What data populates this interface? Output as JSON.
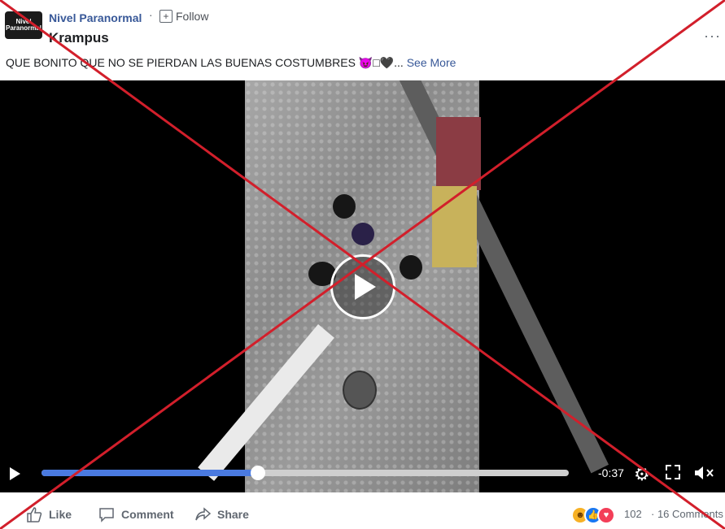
{
  "post": {
    "page_name": "Nivel Paranormal",
    "separator": "·",
    "follow_label": "Follow",
    "title": "Krampus",
    "more_label": "···",
    "caption_text": "QUE BONITO QUE NO SE PIERDAN LAS BUENAS COSTUMBRES 😈□🖤...",
    "see_more_label": "See More",
    "avatar_text": "Nivel Paranormal"
  },
  "video": {
    "time_remaining": "-0:37",
    "progress_fraction": 0.41
  },
  "actions": {
    "like_label": "Like",
    "comment_label": "Comment",
    "share_label": "Share"
  },
  "stats": {
    "reaction_count": "102",
    "comments_label": "· 16 Comments"
  },
  "overlay": {
    "cross_color": "#d21f2b"
  },
  "icons": [
    "avatar-logo",
    "follow-icon",
    "more-options-icon",
    "play-icon",
    "settings-gear-icon",
    "fullscreen-icon",
    "mute-icon",
    "like-icon",
    "comment-icon",
    "share-icon",
    "haha-reaction-icon",
    "like-reaction-icon",
    "love-reaction-icon"
  ],
  "colors": {
    "link_blue": "#385898",
    "progress_blue": "#4a7ae0",
    "text_gray": "#606770"
  }
}
